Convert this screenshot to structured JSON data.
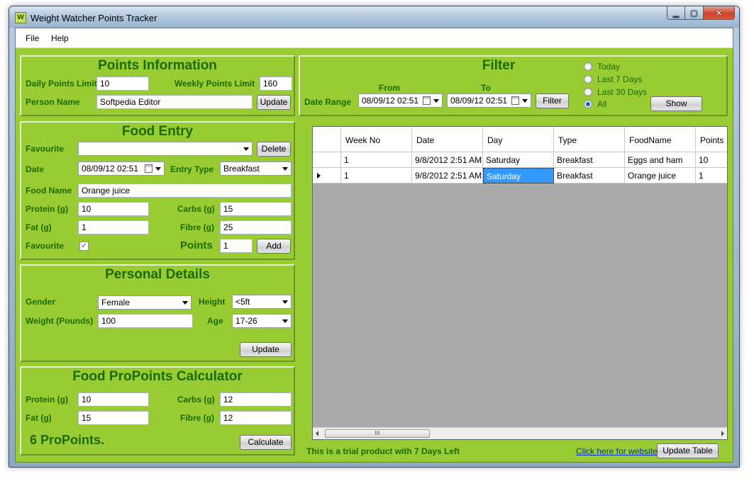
{
  "window": {
    "title": "Weight Watcher Points Tracker",
    "icon_letters": "W"
  },
  "menu": {
    "file": "File",
    "help": "Help"
  },
  "points_info": {
    "title": "Points Information",
    "daily_label": "Daily Points Limit",
    "daily_value": "10",
    "weekly_label": "Weekly Points Limit",
    "weekly_value": "160",
    "person_label": "Person Name",
    "person_value": "Softpedia Editor",
    "update_label": "Update"
  },
  "food_entry": {
    "title": "Food Entry",
    "favourite_label": "Favourite",
    "favourite_value": "",
    "delete_label": "Delete",
    "date_label": "Date",
    "date_value": "08/09/12 02:51",
    "entry_type_label": "Entry Type",
    "entry_type_value": "Breakfast",
    "food_name_label": "Food Name",
    "food_name_value": "Orange juice",
    "protein_label": "Protein (g)",
    "protein_value": "10",
    "carbs_label": "Carbs (g)",
    "carbs_value": "15",
    "fat_label": "Fat (g)",
    "fat_value": "1",
    "fibre_label": "Fibre (g)",
    "fibre_value": "25",
    "favourite_check_label": "Favourite",
    "favourite_checked": "✓",
    "points_label": "Points",
    "points_value": "1",
    "add_label": "Add"
  },
  "personal": {
    "title": "Personal Details",
    "gender_label": "Gender",
    "gender_value": "Female",
    "height_label": "Height",
    "height_value": "<5ft",
    "weight_label": "Weight (Pounds)",
    "weight_value": "100",
    "age_label": "Age",
    "age_value": "17-26",
    "update_label": "Update"
  },
  "calculator": {
    "title": "Food ProPoints Calculator",
    "protein_label": "Protein (g)",
    "protein_value": "10",
    "carbs_label": "Carbs (g)",
    "carbs_value": "12",
    "fat_label": "Fat (g)",
    "fat_value": "15",
    "fibre_label": "Fibre (g)",
    "fibre_value": "12",
    "result": "6 ProPoints.",
    "calculate_label": "Calculate"
  },
  "filter": {
    "title": "Filter",
    "from_label": "From",
    "to_label": "To",
    "date_range_label": "Date Range",
    "from_value": "08/09/12 02:51",
    "to_value": "08/09/12 02:51",
    "filter_label": "Filter",
    "options": [
      "Today",
      "Last 7 Days",
      "Last 30 Days",
      "All"
    ],
    "show_label": "Show"
  },
  "table": {
    "columns": [
      "Week No",
      "Date",
      "Day",
      "Type",
      "FoodName",
      "Points"
    ],
    "rows": [
      [
        "1",
        "9/8/2012 2:51 AM",
        "Saturday",
        "Breakfast",
        "Eggs and ham",
        "10"
      ],
      [
        "1",
        "9/8/2012 2:51 AM",
        "Saturday",
        "Breakfast",
        "Orange juice",
        "1"
      ]
    ],
    "scroll_grip": "III"
  },
  "footer": {
    "trial_text": "This is a trial product with 7 Days Left",
    "website_link": "Click here for website",
    "update_table_label": "Update Table"
  }
}
